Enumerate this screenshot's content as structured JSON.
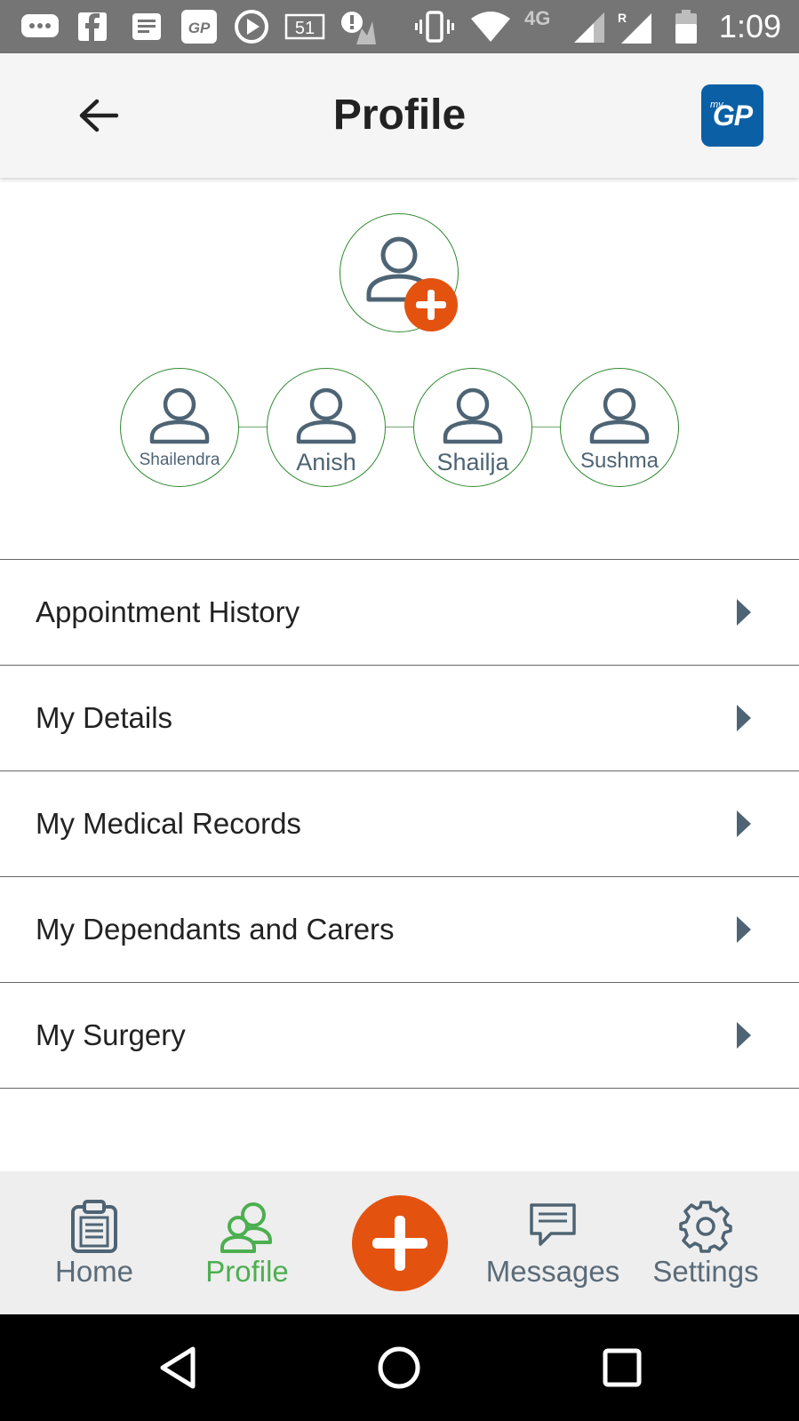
{
  "status_bar": {
    "time": "1:09",
    "network": "4G",
    "icons": [
      "chat-icon",
      "facebook-icon",
      "notes-icon",
      "mygp-icon",
      "play-icon",
      "calendar-icon",
      "alert-icon",
      "vibrate-icon",
      "wifi-icon",
      "signal-icon",
      "signal-roaming-icon",
      "battery-icon"
    ],
    "calendar_badge": "51",
    "app_badge": "GP",
    "roaming": "R"
  },
  "header": {
    "title": "Profile",
    "logo_text": "GP",
    "logo_prefix": "my"
  },
  "members": [
    {
      "name": "Shailendra"
    },
    {
      "name": "Anish"
    },
    {
      "name": "Shailja"
    },
    {
      "name": "Sushma"
    }
  ],
  "menu": [
    {
      "label": "Appointment History"
    },
    {
      "label": "My Details"
    },
    {
      "label": "My Medical Records"
    },
    {
      "label": "My Dependants and Carers"
    },
    {
      "label": "My Surgery"
    }
  ],
  "bottom_nav": {
    "home": "Home",
    "profile": "Profile",
    "messages": "Messages",
    "settings": "Settings",
    "active": "profile"
  },
  "colors": {
    "accent_orange": "#e4520f",
    "active_green": "#4caf50",
    "circle_border": "#2f8a2f",
    "icon_slate": "#4e6474",
    "logo_blue": "#0b5fa5"
  }
}
